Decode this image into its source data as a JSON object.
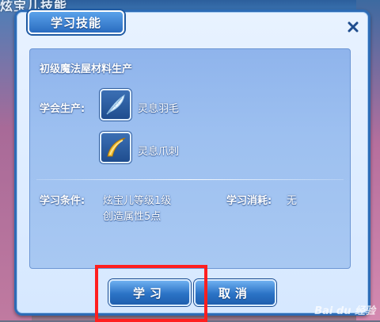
{
  "background": {
    "title": "炫宝儿技能"
  },
  "dialog": {
    "title": "学习技能",
    "close_symbol": "×",
    "skill_title": "初级魔法屋材料生产",
    "learn_label": "学会生产:",
    "products": [
      {
        "name": "灵息羽毛",
        "icon": "feather-icon"
      },
      {
        "name": "灵息爪刺",
        "icon": "claw-icon"
      }
    ],
    "condition_label": "学习条件:",
    "conditions": [
      "炫宝儿等级1级",
      "创造属性5点"
    ],
    "cost_label": "学习消耗:",
    "cost_value": "无",
    "buttons": {
      "learn": "学习",
      "cancel": "取消"
    }
  },
  "watermark": "Bai du 经验",
  "colors": {
    "frame": "#2d6bb5",
    "panel": "#9dc0f0",
    "button": "#2b73c6",
    "highlight": "#ff1f1f"
  }
}
